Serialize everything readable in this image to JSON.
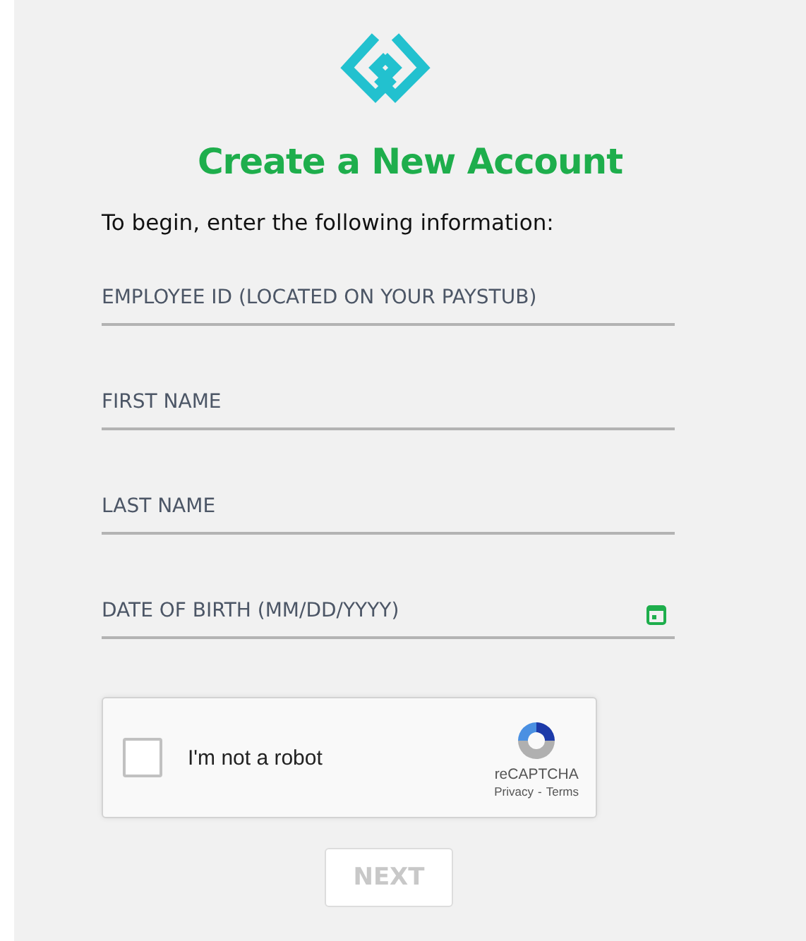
{
  "title": "Create a New Account",
  "intro": "To begin, enter the following information:",
  "fields": [
    {
      "kind": "text",
      "placeholder": "EMPLOYEE ID (LOCATED ON YOUR PAYSTUB)"
    },
    {
      "kind": "text",
      "placeholder": "FIRST NAME"
    },
    {
      "kind": "text",
      "placeholder": "LAST NAME"
    },
    {
      "kind": "date",
      "placeholder": "DATE OF BIRTH (MM/DD/YYYY)"
    }
  ],
  "captcha": {
    "label": "I'm not a robot",
    "checked": false,
    "brand": "reCAPTCHA",
    "links": [
      "Privacy",
      "Terms"
    ],
    "link_separator": "-"
  },
  "next_button": {
    "label": "NEXT",
    "disabled": true
  }
}
